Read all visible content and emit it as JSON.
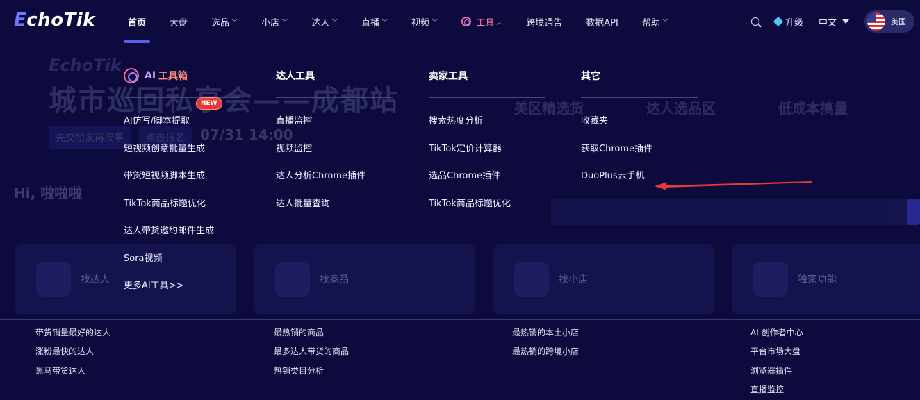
{
  "logo": {
    "text": "choTik",
    "e": "E"
  },
  "nav": {
    "items": [
      {
        "label": "首页",
        "chevron": false
      },
      {
        "label": "大盘",
        "chevron": false
      },
      {
        "label": "选品",
        "chevron": true
      },
      {
        "label": "小店",
        "chevron": true
      },
      {
        "label": "达人",
        "chevron": true
      },
      {
        "label": "直播",
        "chevron": true
      },
      {
        "label": "视频",
        "chevron": true
      },
      {
        "label": "工具",
        "chevron": true
      },
      {
        "label": "跨境通告",
        "chevron": false
      },
      {
        "label": "数据API",
        "chevron": false
      },
      {
        "label": "帮助",
        "chevron": true
      }
    ],
    "upgrade": "升级",
    "language": "中文",
    "region": "美国"
  },
  "menu": {
    "ai": {
      "title_prefix": "AI",
      "title": "工具箱",
      "badge": "NEW",
      "items": [
        "AI仿写/脚本提取",
        "短视频创意批量生成",
        "带货短视频脚本生成",
        "TikTok商品标题优化",
        "达人带货邀约邮件生成",
        "Sora视频",
        "更多AI工具>>"
      ]
    },
    "influencer": {
      "title": "达人工具",
      "items": [
        "直播监控",
        "视频监控",
        "达人分析Chrome插件",
        "达人批量查询"
      ]
    },
    "seller": {
      "title": "卖家工具",
      "items": [
        "搜索热度分析",
        "TikTok定价计算器",
        "选品Chrome插件",
        "TikTok商品标题优化"
      ]
    },
    "other": {
      "title": "其它",
      "items": [
        "收藏夹",
        "获取Chrome插件",
        "DuoPlus云手机"
      ]
    }
  },
  "background": {
    "logo": "EchoTik",
    "title": "城市巡回私享会——成都站",
    "chip": "先交朋友再搞事",
    "chip2": "点击报名",
    "date": "07/31 14:00",
    "categories": [
      "美区精选货",
      "达人选品区",
      "低成本搞量"
    ],
    "greeting": "Hi, 啦啦啦",
    "cards": [
      "找达人",
      "找商品",
      "找小店",
      "独家功能"
    ]
  },
  "footer": {
    "col1": [
      "带货销量最好的达人",
      "涨粉最快的达人",
      "黑马带货达人"
    ],
    "col2": [
      "最热销的商品",
      "最多达人带货的商品",
      "热销类目分析"
    ],
    "col3": [
      "最热销的本土小店",
      "最热销的跨境小店"
    ],
    "col4": [
      "AI 创作者中心",
      "平台市场大盘",
      "浏览器插件",
      "直播监控"
    ]
  },
  "colors": {
    "background": "#0d0b3e",
    "accent": "#5b5ef0",
    "annotation_arrow": "#e53935",
    "badge": "#e53935"
  }
}
